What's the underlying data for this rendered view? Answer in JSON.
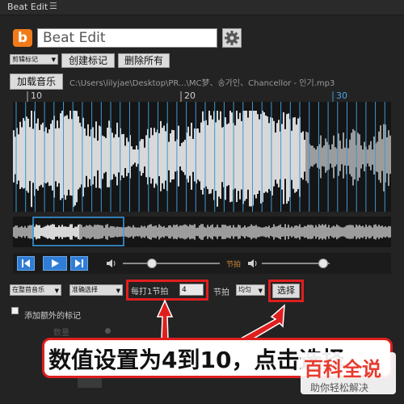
{
  "app": {
    "title": "Beat Edit",
    "menu_icon": "hamburger-icon"
  },
  "header": {
    "logo_letter": "b",
    "project_name": "Beat Edit",
    "settings_icon": "gear-icon"
  },
  "toolbar": {
    "marker_select": "剪辑标记",
    "create_marker": "创建标记",
    "delete_all": "删除所有",
    "load_music": "加载音乐",
    "file_path": "C:\\Users\\lilyjae\\Desktop\\PR...\\MC梦、송가인、Chancellor - 인기.mp3"
  },
  "timeline": {
    "ticks": [
      "10",
      "20",
      "30"
    ],
    "colors": {
      "wave_light": "#d8d8d8",
      "wave_dark": "#9c9c9c",
      "beat_line": "#3a9ad9",
      "selection": "#3aa0e8"
    }
  },
  "transport": {
    "rewind_icon": "skip-back-icon",
    "play_icon": "play-icon",
    "forward_icon": "skip-forward-icon",
    "volume_icon": "speaker-icon",
    "beat_label": "节拍",
    "beat_volume_icon": "speaker-icon",
    "volume_level": 0.3,
    "beat_volume_level": 0.9
  },
  "controls": {
    "range_select": "在整首音乐",
    "accuracy_select": "准确选择",
    "every_label": "每打1节拍",
    "every_value": "4",
    "beat_label": "节拍",
    "mode_select": "均匀",
    "select_button": "选择",
    "extra_markers": "添加额外的标记",
    "count_label": "数量"
  },
  "annotation": {
    "text": "数值设置为4到10，点击选择",
    "accent": "#e01e1e"
  },
  "watermark": {
    "big": "百科全说",
    "small": "助你轻松解决"
  }
}
